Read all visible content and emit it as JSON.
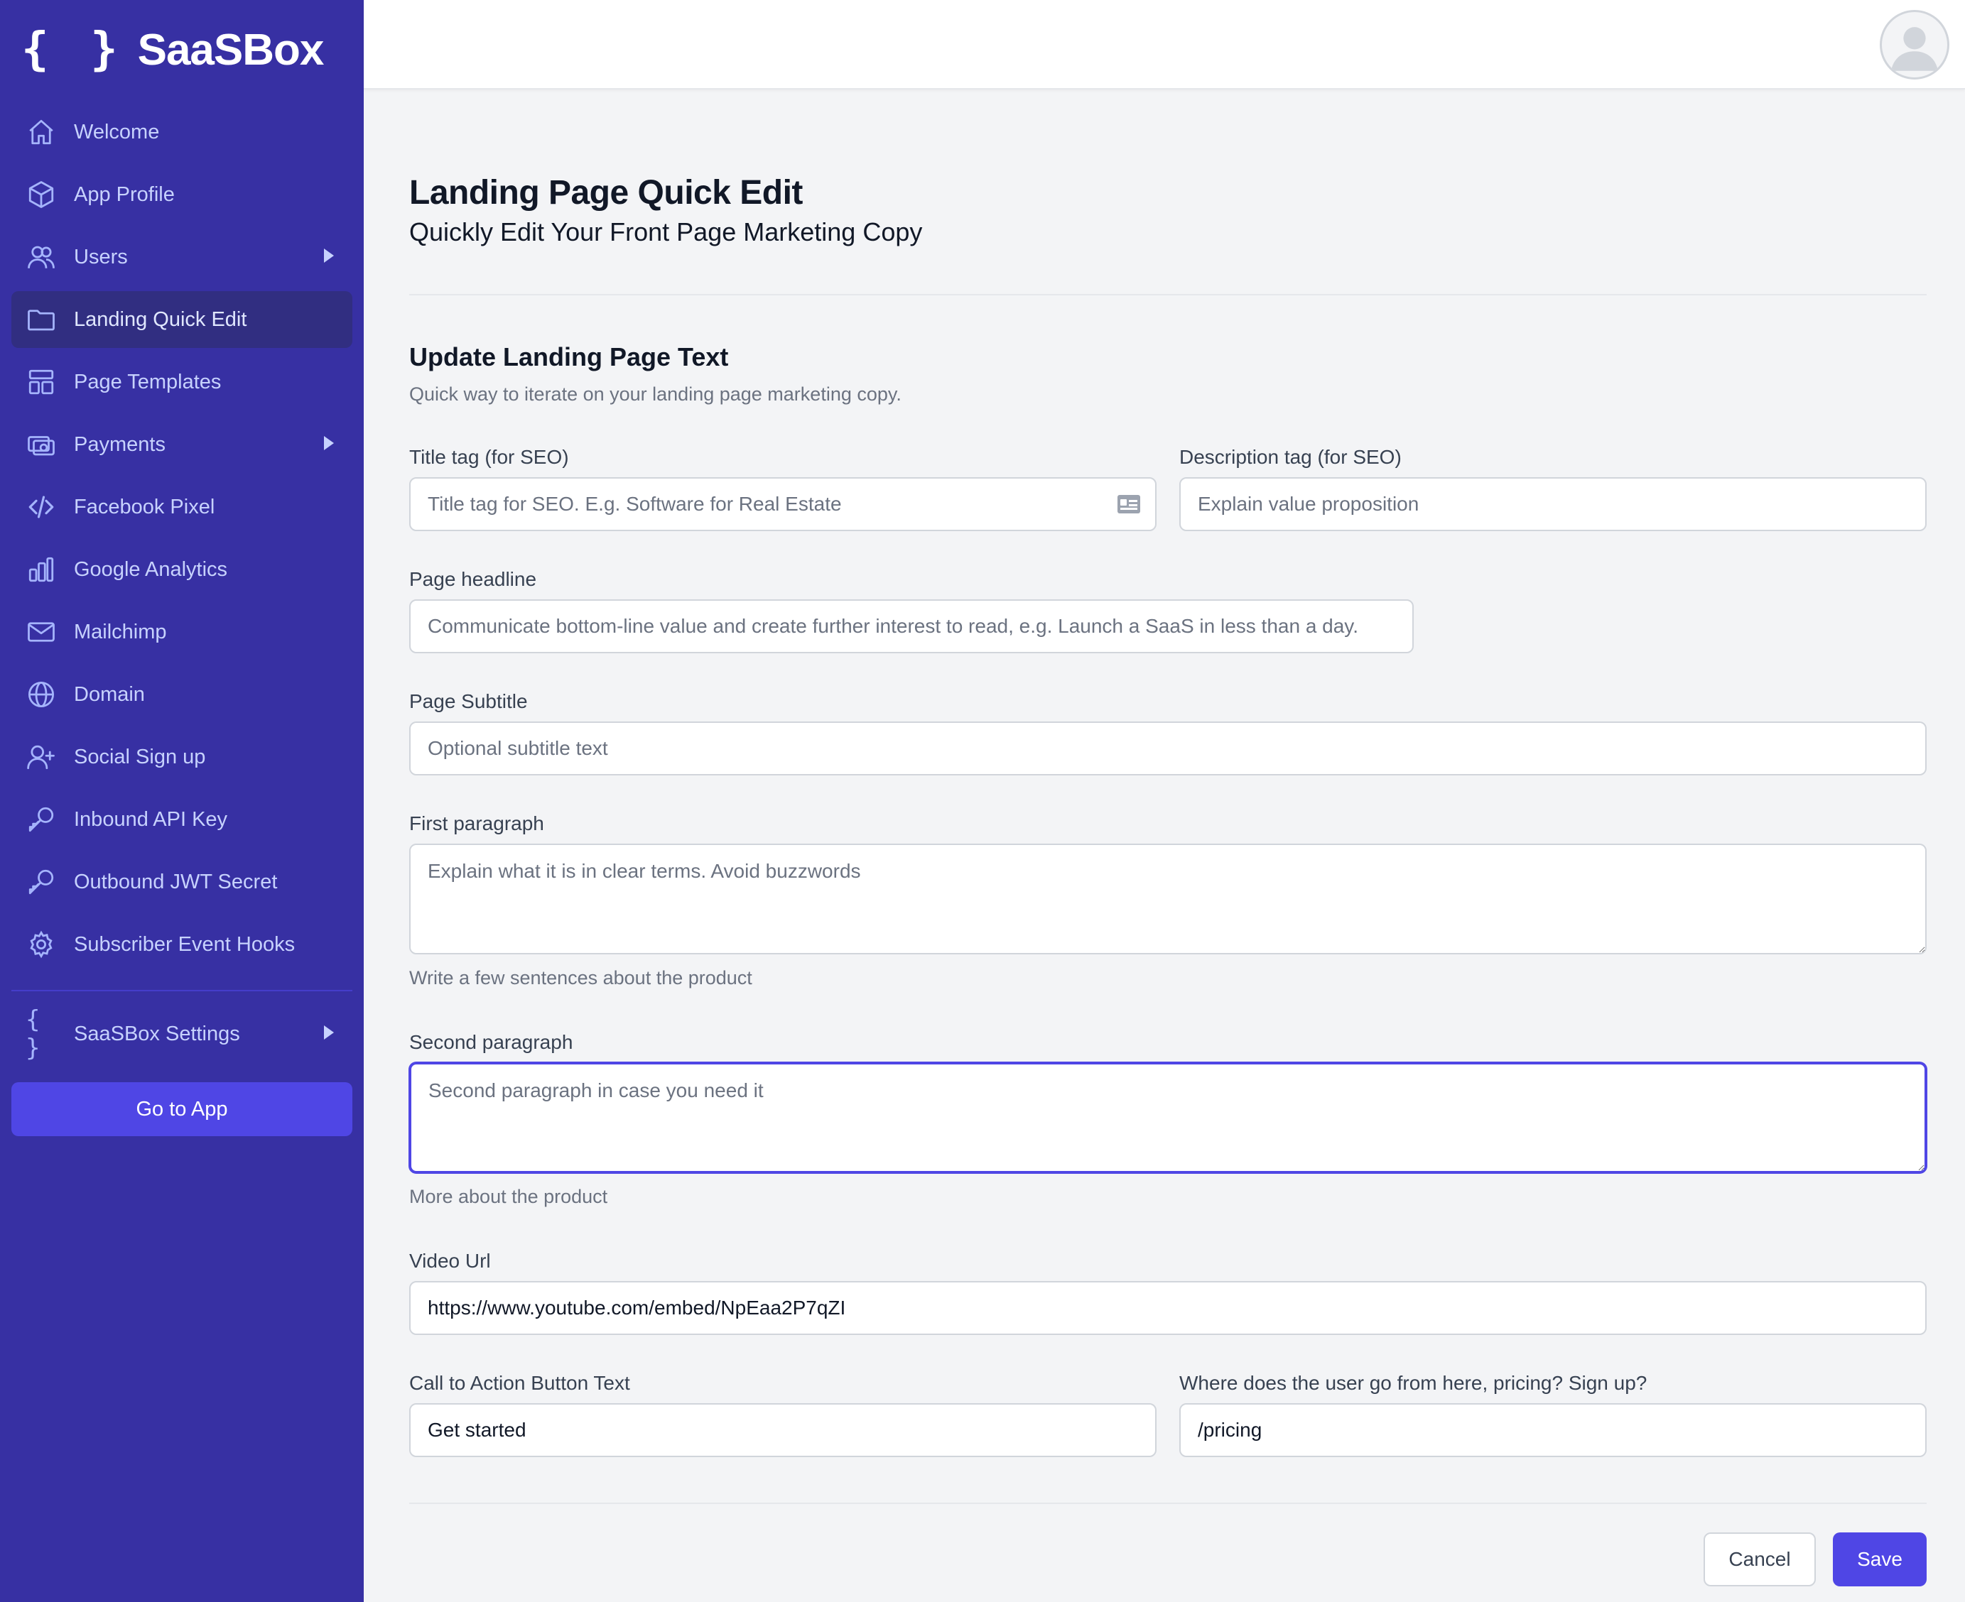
{
  "brand": {
    "name": "SaaSBox",
    "braces": "{ }"
  },
  "sidebar": {
    "items": [
      {
        "label": "Welcome",
        "icon": "home-icon",
        "caret": false,
        "active": false
      },
      {
        "label": "App Profile",
        "icon": "cube-icon",
        "caret": false,
        "active": false
      },
      {
        "label": "Users",
        "icon": "users-icon",
        "caret": true,
        "active": false
      },
      {
        "label": "Landing Quick Edit",
        "icon": "folder-icon",
        "caret": false,
        "active": true
      },
      {
        "label": "Page Templates",
        "icon": "template-icon",
        "caret": false,
        "active": false
      },
      {
        "label": "Payments",
        "icon": "cash-icon",
        "caret": true,
        "active": false
      },
      {
        "label": "Facebook Pixel",
        "icon": "code-icon",
        "caret": false,
        "active": false
      },
      {
        "label": "Google Analytics",
        "icon": "chart-bar-icon",
        "caret": false,
        "active": false
      },
      {
        "label": "Mailchimp",
        "icon": "mail-icon",
        "caret": false,
        "active": false
      },
      {
        "label": "Domain",
        "icon": "globe-icon",
        "caret": false,
        "active": false
      },
      {
        "label": "Social Sign up",
        "icon": "user-add-icon",
        "caret": false,
        "active": false
      },
      {
        "label": "Inbound API Key",
        "icon": "key-icon",
        "caret": false,
        "active": false
      },
      {
        "label": "Outbound JWT Secret",
        "icon": "key-icon",
        "caret": false,
        "active": false
      },
      {
        "label": "Subscriber Event Hooks",
        "icon": "gear-icon",
        "caret": false,
        "active": false
      }
    ],
    "settings": {
      "label": "SaaSBox Settings",
      "icon": "braces-icon"
    },
    "go_to_app": "Go to App"
  },
  "header": {
    "avatar_icon": "user-avatar-icon"
  },
  "page": {
    "title": "Landing Page Quick Edit",
    "subtitle": "Quickly Edit Your Front Page Marketing Copy",
    "section_title": "Update Landing Page Text",
    "section_desc": "Quick way to iterate on your landing page marketing copy."
  },
  "form": {
    "title_tag": {
      "label": "Title tag (for SEO)",
      "placeholder": "Title tag for SEO. E.g. Software for Real Estate",
      "value": ""
    },
    "description_tag": {
      "label": "Description tag (for SEO)",
      "placeholder": "Explain value proposition",
      "value": ""
    },
    "headline": {
      "label": "Page headline",
      "placeholder": "Communicate bottom-line value and create further interest to read, e.g. Launch a SaaS in less than a day.",
      "value": ""
    },
    "subtitle": {
      "label": "Page Subtitle",
      "placeholder": "Optional subtitle text",
      "value": ""
    },
    "first_paragraph": {
      "label": "First paragraph",
      "placeholder": "Explain what it is in clear terms. Avoid buzzwords",
      "help": "Write a few sentences about the product"
    },
    "second_paragraph": {
      "label": "Second paragraph",
      "placeholder": "Second paragraph in case you need it",
      "help": "More about the product"
    },
    "video_url": {
      "label": "Video Url",
      "value": "https://www.youtube.com/embed/NpEaa2P7qZI"
    },
    "cta_text": {
      "label": "Call to Action Button Text",
      "value": "Get started"
    },
    "cta_target": {
      "label": "Where does the user go from here, pricing? Sign up?",
      "value": "/pricing"
    }
  },
  "actions": {
    "cancel": "Cancel",
    "save": "Save"
  },
  "colors": {
    "sidebar_bg": "#3730a3",
    "sidebar_active": "#312e81",
    "accent": "#4f46e5",
    "page_bg": "#f3f4f6"
  }
}
